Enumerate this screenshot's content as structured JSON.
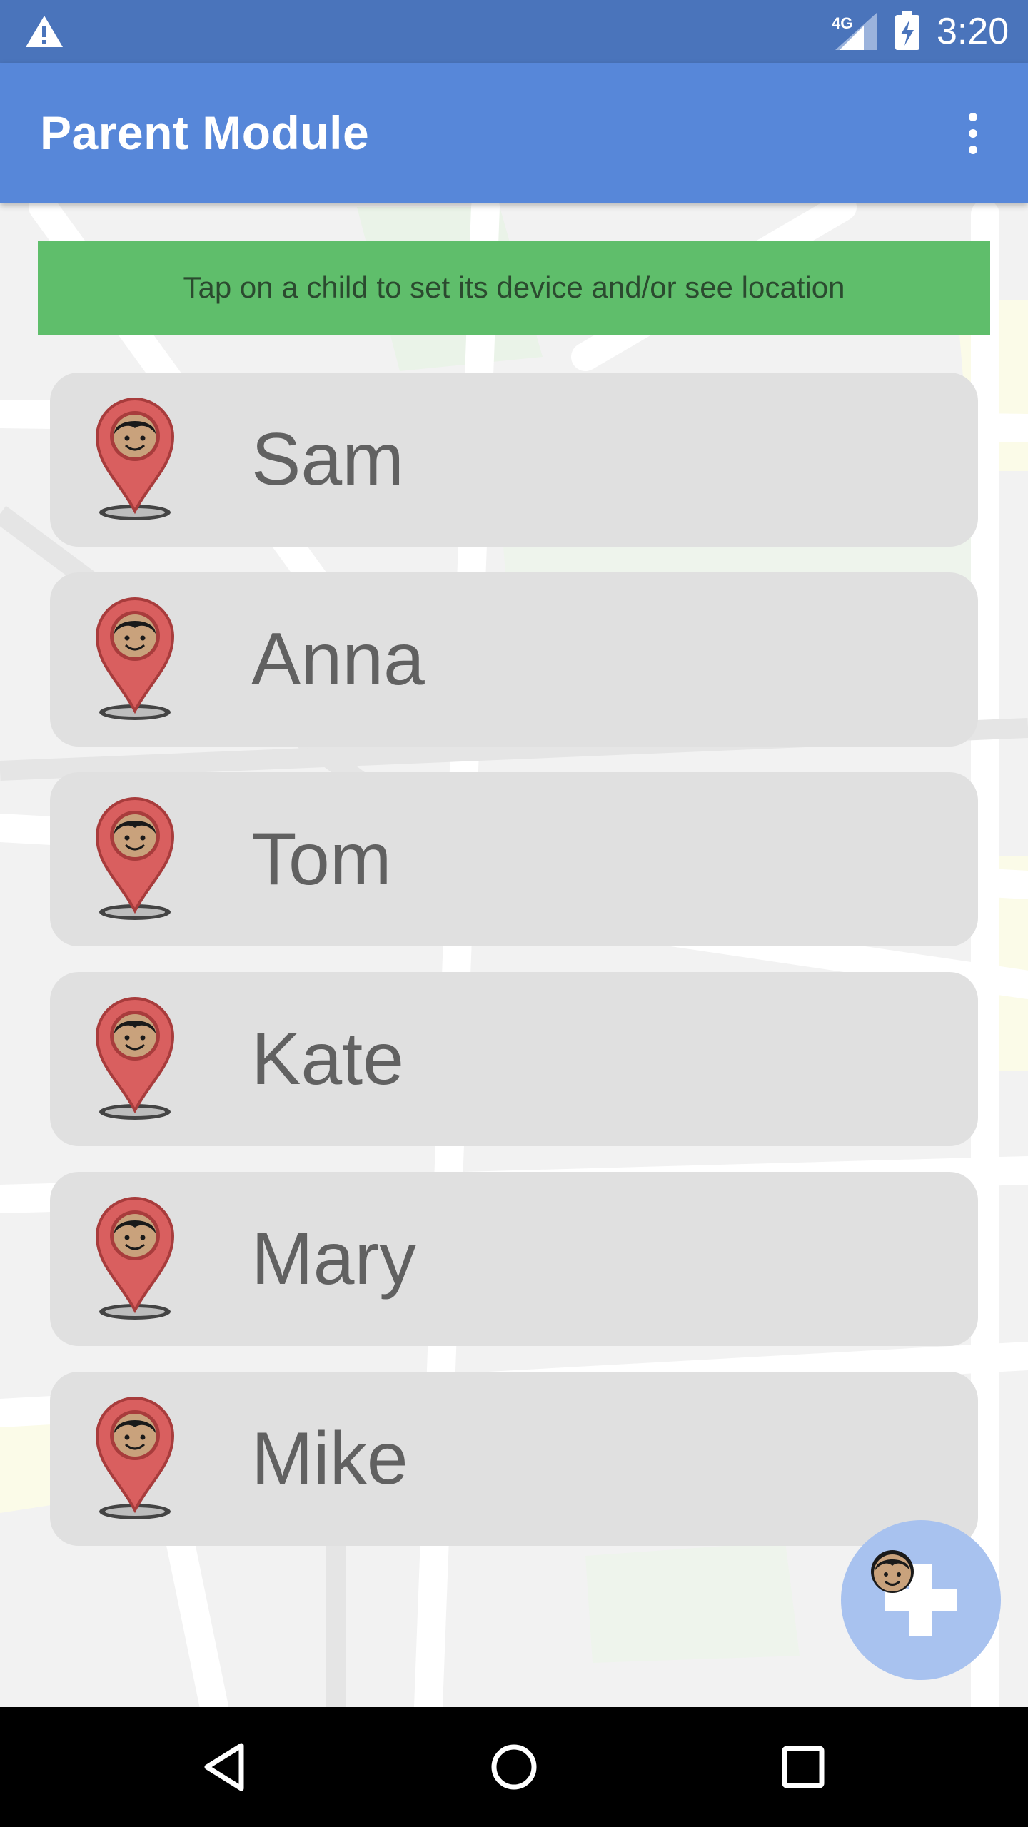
{
  "status_bar": {
    "network_label": "4G",
    "time": "3:20"
  },
  "app_bar": {
    "title": "Parent Module",
    "overflow_icon": "more-vert-icon"
  },
  "banner": {
    "text": "Tap on a child to set its device and/or see location",
    "color": "#5fbe6b"
  },
  "children": [
    {
      "name": "Sam",
      "icon": "child-location-pin-icon"
    },
    {
      "name": "Anna",
      "icon": "child-location-pin-icon"
    },
    {
      "name": "Tom",
      "icon": "child-location-pin-icon"
    },
    {
      "name": "Kate",
      "icon": "child-location-pin-icon"
    },
    {
      "name": "Mary",
      "icon": "child-location-pin-icon"
    },
    {
      "name": "Mike",
      "icon": "child-location-pin-icon"
    }
  ],
  "fab": {
    "icon": "add-child-icon"
  },
  "nav_bar": {
    "back_icon": "back-triangle-icon",
    "home_icon": "home-circle-icon",
    "recents_icon": "recents-square-icon"
  },
  "colors": {
    "status_bar": "#4a74bb",
    "app_bar": "#5787d9",
    "row": "#e0e0e0",
    "pin": "#d95f5f",
    "fab": "#a8c2ef"
  }
}
